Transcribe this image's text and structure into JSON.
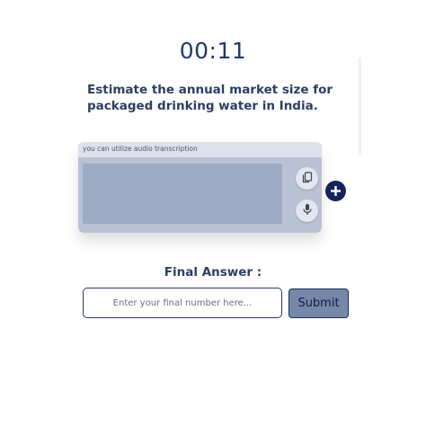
{
  "timer": {
    "value": "00:11"
  },
  "question": {
    "text": "Estimate the annual market size for packaged drinking water in India."
  },
  "transcription": {
    "hint": "you can  utilize audio transcription",
    "copy_icon": "copy-icon",
    "mic_icon": "microphone-icon",
    "add_icon": "plus-icon"
  },
  "answer": {
    "label": "Final Answer :",
    "placeholder": "Enter your final number here...",
    "value": "",
    "submit_label": "Submit"
  },
  "colors": {
    "primary_dark": "#1f3a6b",
    "card_bg": "#b9c2d4",
    "text_area_bg": "#9dabc5",
    "submit_bg": "#7688a8",
    "plus_bg": "#16235a"
  }
}
